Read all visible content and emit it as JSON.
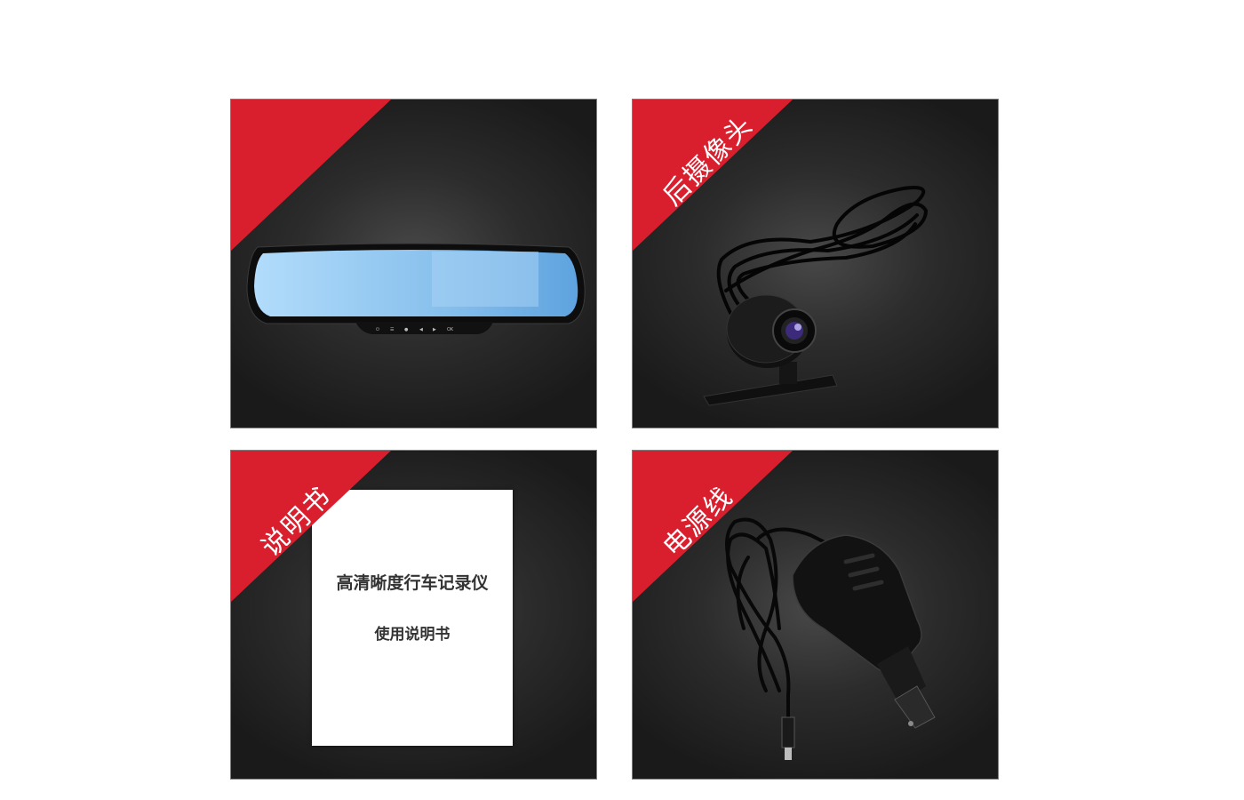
{
  "tiles": [
    {
      "id": "mirror-dvr",
      "ribbon_label": "",
      "buttons": [
        "⏻",
        "☰",
        "●",
        "◀",
        "▶",
        "OK"
      ]
    },
    {
      "id": "rear-camera",
      "ribbon_label": "后摄像头"
    },
    {
      "id": "manual",
      "ribbon_label": "说明书",
      "doc_title": "高清晰度行车记录仪",
      "doc_subtitle": "使用说明书"
    },
    {
      "id": "power-cable",
      "ribbon_label": "电源线"
    }
  ],
  "colors": {
    "ribbon": "#d91f2e",
    "background": "#ffffff",
    "tile_dark": "#1a1a1a",
    "mirror_blue": "#8cc4ee"
  }
}
